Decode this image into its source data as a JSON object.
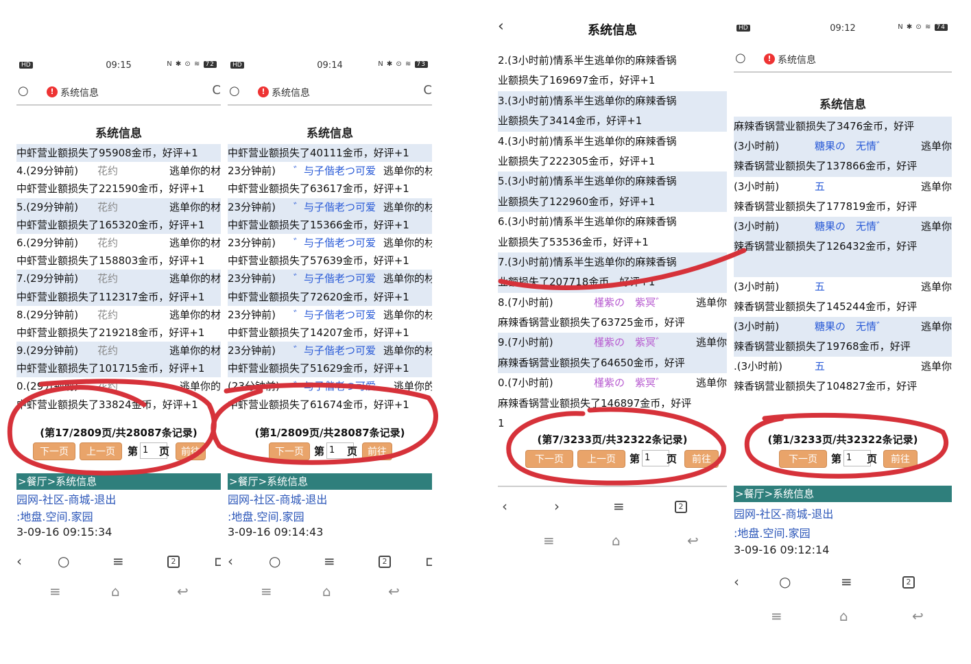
{
  "common": {
    "page_title": "系统信息",
    "search_title": "系统信息",
    "btn_next": "下一页",
    "btn_prev": "上一页",
    "label_di": "第",
    "label_ye": "页",
    "btn_go": "前往",
    "teal_nav": ">餐厅>系统信息",
    "links_line": "园网-社区-商城-退出",
    "links_line2": ":地盘.空间.家园"
  },
  "panel1": {
    "time": "09:15",
    "battery": "72",
    "rows": [
      {
        "a": "",
        "b": "中虾营业额损失了95908金币，好评+1",
        "shade": true
      },
      {
        "a": "4.(29分钟前)",
        "n": "花约",
        "act": "逃单你的材"
      },
      {
        "b": "中虾营业额损失了221590金币，好评+1"
      },
      {
        "a": "5.(29分钟前)",
        "n": "花约",
        "act": "逃单你的材",
        "shade": true
      },
      {
        "b": "中虾营业额损失了165320金币，好评+1",
        "shade": true
      },
      {
        "a": "6.(29分钟前)",
        "n": "花约",
        "act": "逃单你的材"
      },
      {
        "b": "中虾营业额损失了158803金币，好评+1"
      },
      {
        "a": "7.(29分钟前)",
        "n": "花约",
        "act": "逃单你的材",
        "shade": true
      },
      {
        "b": "中虾营业额损失了112317金币，好评+1",
        "shade": true
      },
      {
        "a": "8.(29分钟前)",
        "n": "花约",
        "act": "逃单你的材"
      },
      {
        "b": "中虾营业额损失了219218金币，好评+1"
      },
      {
        "a": "9.(29分钟前)",
        "n": "花约",
        "act": "逃单你的材",
        "shade": true
      },
      {
        "b": "中虾营业额损失了101715金币，好评+1",
        "shade": true
      },
      {
        "a": "0.(29分钟前)",
        "n": "花约",
        "act": "逃单你的"
      },
      {
        "b": "中虾营业额损失了33824金币，好评+1"
      }
    ],
    "pager_info": "(第17/2809页/共28087条记录)",
    "page_input": "1",
    "timestamp": "3-09-16 09:15:34"
  },
  "panel2": {
    "time": "09:14",
    "battery": "73",
    "rows": [
      {
        "b": "中虾营业额损失了40111金币，好评+1",
        "shade": true
      },
      {
        "a": "23分钟前)",
        "n": "゛与子偕老つ可爱",
        "act": "逃单你的材"
      },
      {
        "b": "中虾营业额损失了63617金币，好评+1"
      },
      {
        "a": "23分钟前)",
        "n": "゛与子偕老つ可爱",
        "act": "逃单你的材",
        "shade": true
      },
      {
        "b": "中虾营业额损失了15366金币，好评+1",
        "shade": true
      },
      {
        "a": "23分钟前)",
        "n": "゛与子偕老つ可爱",
        "act": "逃单你的材"
      },
      {
        "b": "中虾营业额损失了57639金币，好评+1"
      },
      {
        "a": "23分钟前)",
        "n": "゛与子偕老つ可爱",
        "act": "逃单你的材",
        "shade": true
      },
      {
        "b": "中虾营业额损失了72620金币，好评+1",
        "shade": true
      },
      {
        "a": "23分钟前)",
        "n": "゛与子偕老つ可爱",
        "act": "逃单你的材"
      },
      {
        "b": "中虾营业额损失了14207金币，好评+1"
      },
      {
        "a": "23分钟前)",
        "n": "゛与子偕老つ可爱",
        "act": "逃单你的材",
        "shade": true
      },
      {
        "b": "中虾营业额损失了51629金币，好评+1",
        "shade": true
      },
      {
        "a": "(23分钟前)",
        "n": "゛与子偕老つ可爱",
        "act": "逃单你的"
      },
      {
        "b": "中虾营业额损失了61674金币，好评+1"
      }
    ],
    "pager_info": "(第1/2809页/共28087条记录)",
    "page_input": "1",
    "timestamp": "3-09-16 09:14:43"
  },
  "panel3": {
    "rows": [
      {
        "b": "2.(3小时前)情系半生逃单你的麻辣香锅"
      },
      {
        "b": "业额损失了169697金币，好评+1"
      },
      {
        "b": "3.(3小时前)情系半生逃单你的麻辣香锅",
        "shade": true
      },
      {
        "b": "业额损失了3414金币，好评+1",
        "shade": true
      },
      {
        "b": "4.(3小时前)情系半生逃单你的麻辣香锅"
      },
      {
        "b": "业额损失了222305金币，好评+1"
      },
      {
        "b": "5.(3小时前)情系半生逃单你的麻辣香锅",
        "shade": true
      },
      {
        "b": "业额损失了122960金币，好评+1",
        "shade": true
      },
      {
        "b": "6.(3小时前)情系半生逃单你的麻辣香锅"
      },
      {
        "b": "业额损失了53536金币，好评+1"
      },
      {
        "b": "7.(3小时前)情系半生逃单你的麻辣香锅",
        "shade": true
      },
      {
        "b": "业额损失了207718金币，好评+1",
        "shade": true
      },
      {
        "a": "8.(7小时前)",
        "n": "槿紫の　紫冥゛",
        "act": "逃单你"
      },
      {
        "b": "麻辣香锅营业额损失了63725金币，好评"
      },
      {
        "a": "9.(7小时前)",
        "n": "槿紫の　紫冥゛",
        "act": "逃单你",
        "shade": true
      },
      {
        "b": "麻辣香锅营业额损失了64650金币，好评",
        "shade": true
      },
      {
        "a": "0.(7小时前)",
        "n": "槿紫の　紫冥゛",
        "act": "逃单你"
      },
      {
        "b": "麻辣香锅营业额损失了146897金币，好评"
      },
      {
        "b": "1"
      }
    ],
    "pager_info": "(第7/3233页/共32322条记录)",
    "page_input": "1"
  },
  "panel4": {
    "time": "09:12",
    "battery": "74",
    "rows": [
      {
        "b": "麻辣香锅营业额损失了3476金币，好评",
        "shade": true
      },
      {
        "a": "(3小时前)",
        "n": "糖果の　无情゛",
        "act": "逃单你",
        "shade": true
      },
      {
        "b": "辣香锅营业额损失了137866金币，好评",
        "shade": true
      },
      {
        "a": "(3小时前)",
        "n": "五",
        "act": "逃单你"
      },
      {
        "b": "辣香锅营业额损失了177819金币，好评"
      },
      {
        "a": "(3小时前)",
        "n": "糖果の　无情゛",
        "act": "逃单你",
        "shade": true
      },
      {
        "b": "辣香锅营业额损失了126432金币，好评",
        "shade": true
      },
      {
        "b": "",
        "shade": true
      },
      {
        "a": "(3小时前)",
        "n": "五",
        "act": "逃单你"
      },
      {
        "b": "辣香锅营业额损失了145244金币，好评"
      },
      {
        "a": "(3小时前)",
        "n": "糖果の　无情゛",
        "act": "逃单你",
        "shade": true
      },
      {
        "b": "辣香锅营业额损失了19768金币，好评",
        "shade": true
      },
      {
        "a": ".(3小时前)",
        "n": "五",
        "act": "逃单你"
      },
      {
        "b": "辣香锅营业额损失了104827金币，好评"
      }
    ],
    "pager_info": "(第1/3233页/共32322条记录)",
    "page_input": "1",
    "timestamp": "3-09-16 09:12:14"
  },
  "colors": {
    "row_shade": "#e1e9f4",
    "button": "#e9a46a",
    "teal": "#2f7f7c",
    "link": "#2a55b8",
    "ink_circle": "#d6323a"
  },
  "icons": [
    "search-icon",
    "warning-icon",
    "reload-icon",
    "back-icon",
    "forward-icon",
    "menu-icon",
    "tabs-icon",
    "home-icon",
    "return-icon"
  ]
}
